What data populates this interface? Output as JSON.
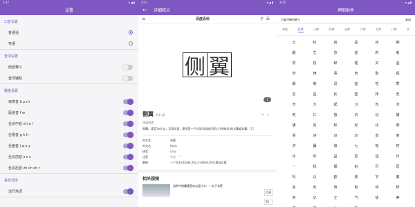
{
  "status": {
    "time": "3:37",
    "time2": "3:35",
    "icons": "▾◢▮"
  },
  "settings": {
    "title": "设置",
    "sections": [
      {
        "header": "口音设置",
        "items": [
          {
            "label": "普通话",
            "control": "radio",
            "on": true
          },
          {
            "label": "粤语",
            "control": "radio",
            "on": false
          }
        ]
      },
      {
        "header": "查词设置",
        "items": [
          {
            "label": "侧查释义",
            "control": "toggle",
            "on": false
          },
          {
            "label": "查词辅助",
            "control": "toggle",
            "on": false
          }
        ]
      },
      {
        "header": "键盘设置",
        "items": [
          {
            "label": "双高音 b p m",
            "control": "toggle",
            "on": true
          },
          {
            "label": "唇齿音 f w",
            "control": "toggle",
            "on": true
          },
          {
            "label": "舌尖中音 d t n l",
            "control": "toggle",
            "on": true
          },
          {
            "label": "舌根音 g k h",
            "control": "toggle",
            "on": true
          },
          {
            "label": "舌面音 j q x y",
            "control": "toggle",
            "on": true
          },
          {
            "label": "舌尖前音 z c s",
            "control": "toggle",
            "on": true
          },
          {
            "label": "舌尖后音 zh ch sh r",
            "control": "toggle",
            "on": true
          }
        ]
      },
      {
        "header": "系统词库",
        "items": [
          {
            "label": "流行热词",
            "control": "toggle",
            "on": true
          }
        ]
      }
    ]
  },
  "detail": {
    "title": "详细释义",
    "source": "百度百科",
    "char1": "侧",
    "char2": "翼",
    "page_badge": "1",
    "word": "侧翼",
    "pinyin": "[cè yì]",
    "def_line1": "汉语词语",
    "def_line2": "侧翼，读音为cè yì，汉语词语，意思是一个队形(如战线,军队,行进纵队)的左翼或右翼。",
    "def_ref": "[1]",
    "info": [
      {
        "k": "中文名",
        "v": "侧翼"
      },
      {
        "k": "外文名",
        "v": "flank"
      },
      {
        "k": "拼音",
        "v": "cè yì"
      },
      {
        "k": "注音",
        "v": "ㄘㄜˋ ㄧˋ"
      },
      {
        "k": "解释",
        "v": "一个队形(如战线,军队,行进纵队)的左翼或右翼"
      }
    ],
    "related_title": "相关视频",
    "video_title": "战争中侧翼遭受攻击是什么—一次下有警",
    "side_btns": [
      "目录",
      "TA"
    ]
  },
  "assistant": {
    "title": "押韵助手",
    "search_value": "为爱冲锋的勇士",
    "search_btn": "查询",
    "tabs": [
      "单韵",
      "双押",
      "三押",
      "四押",
      "五押",
      "六押",
      "七押",
      "八押",
      "字"
    ],
    "active_tab": 1,
    "chars": [
      "士",
      "纪",
      "启",
      "是",
      "四",
      "制",
      "趣",
      "艺",
      "苏",
      "益",
      "时",
      "者",
      "赞",
      "技",
      "辞",
      "理",
      "实",
      "盗",
      "世",
      "律",
      "事",
      "奇",
      "取",
      "视",
      "朗",
      "制",
      "词",
      "室",
      "吃",
      "质",
      "息",
      "益",
      "比",
      "壁",
      "择",
      "史",
      "市",
      "力",
      "起",
      "习",
      "鸡",
      "济",
      "地",
      "仁",
      "值",
      "识",
      "记",
      "旗",
      "拂",
      "资",
      "积",
      "纪",
      "比",
      "例",
      "易",
      "诗",
      "识",
      "识",
      "道",
      "意",
      "济",
      "器",
      "级",
      "七",
      "吸",
      "时",
      "许",
      "你",
      "益",
      "密",
      "迹",
      "日",
      "一",
      "机",
      "细",
      "射",
      "尽",
      "忍",
      "吗",
      "以",
      "欧",
      "逸",
      "字",
      "离",
      "意",
      "死",
      "奇",
      "取",
      "侍",
      "辞",
      "实",
      "记",
      "立",
      "气",
      "级",
      "美",
      "欢",
      "字",
      "七",
      "戏"
    ]
  }
}
